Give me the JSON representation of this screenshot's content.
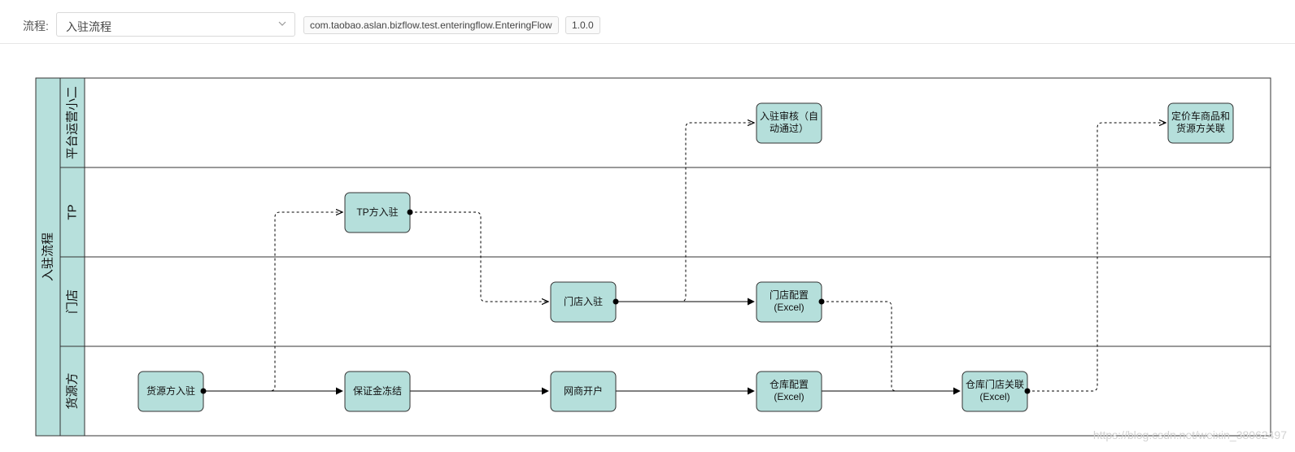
{
  "toolbar": {
    "label": "流程:",
    "selected_flow": "入驻流程",
    "class_name": "com.taobao.aslan.bizflow.test.enteringflow.EnteringFlow",
    "version": "1.0.0",
    "chevron_icon": "chevron-down-icon"
  },
  "diagram": {
    "pool_title": "入驻流程",
    "lanes": [
      "平台运营小二",
      "TP",
      "门店",
      "货源方"
    ],
    "nodes": [
      {
        "id": "audit",
        "lane": "平台运营小二",
        "lines": [
          "入驻审核（自",
          "动通过）"
        ]
      },
      {
        "id": "pricing",
        "lane": "平台运营小二",
        "lines": [
          "定价车商品和",
          "货源方关联"
        ]
      },
      {
        "id": "tp",
        "lane": "TP",
        "lines": [
          "TP方入驻"
        ]
      },
      {
        "id": "store",
        "lane": "门店",
        "lines": [
          "门店入驻"
        ]
      },
      {
        "id": "storecfg",
        "lane": "门店",
        "lines": [
          "门店配置",
          "(Excel)"
        ]
      },
      {
        "id": "supplier",
        "lane": "货源方",
        "lines": [
          "货源方入驻"
        ]
      },
      {
        "id": "deposit",
        "lane": "货源方",
        "lines": [
          "保证金冻结"
        ]
      },
      {
        "id": "account",
        "lane": "货源方",
        "lines": [
          "网商开户"
        ]
      },
      {
        "id": "warehouse",
        "lane": "货源方",
        "lines": [
          "仓库配置",
          "(Excel)"
        ]
      },
      {
        "id": "link",
        "lane": "货源方",
        "lines": [
          "仓库门店关联",
          "(Excel)"
        ]
      }
    ],
    "edges": [
      {
        "from": "supplier",
        "to": "deposit",
        "style": "solid"
      },
      {
        "from": "supplier",
        "to": "tp",
        "style": "dashed"
      },
      {
        "from": "deposit",
        "to": "account",
        "style": "solid"
      },
      {
        "from": "account",
        "to": "warehouse",
        "style": "solid"
      },
      {
        "from": "tp",
        "to": "store",
        "style": "dashed"
      },
      {
        "from": "store",
        "to": "storecfg",
        "style": "solid"
      },
      {
        "from": "store",
        "to": "audit",
        "style": "dashed"
      },
      {
        "from": "storecfg",
        "to": "link",
        "style": "dashed"
      },
      {
        "from": "warehouse",
        "to": "link",
        "style": "solid"
      },
      {
        "from": "link",
        "to": "pricing",
        "style": "dashed"
      }
    ],
    "colors": {
      "lane_fill": "#b7e0dc",
      "node_fill": "#b5dfdb",
      "stroke": "#333333"
    }
  },
  "watermark": "https://blog.csdn.net/weixin_38062497"
}
